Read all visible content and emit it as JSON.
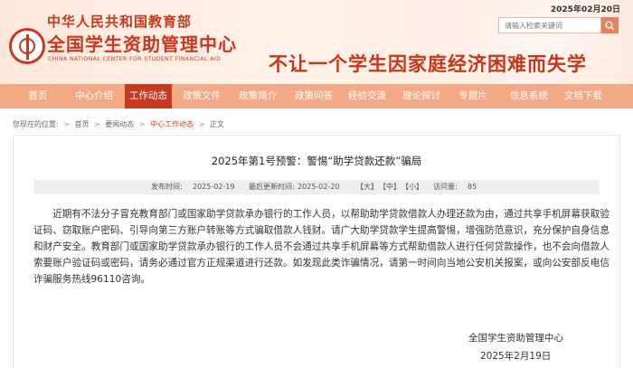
{
  "header": {
    "date": "2025年02月20日",
    "ministry": "中华人民共和国教育部",
    "center_name": "全国学生资助管理中心",
    "center_en": "CHINA NATIONAL CENTER FOR STUDENT FINANCIAL AID",
    "slogan": "不让一个学生因家庭经济困难而失学",
    "search": {
      "placeholder": "请输入检索关键词"
    }
  },
  "nav": {
    "items": [
      {
        "label": "首页"
      },
      {
        "label": "中心介绍"
      },
      {
        "label": "工作动态",
        "active": true
      },
      {
        "label": "政策文件"
      },
      {
        "label": "政策简介"
      },
      {
        "label": "政策问答"
      },
      {
        "label": "经验交流"
      },
      {
        "label": "理论探讨"
      },
      {
        "label": "专题片"
      },
      {
        "label": "信息系统"
      },
      {
        "label": "文档下载"
      }
    ]
  },
  "breadcrumb": {
    "prefix": "您现在的位置:",
    "items": [
      "首页",
      "要闻动态",
      "中心工作动态",
      "正文"
    ]
  },
  "article": {
    "title": "2025年第1号预警：警惕“助学贷款还款”骗局",
    "publish_label": "发布时间:",
    "publish_date": "2025-02-19",
    "update_label": "最后更新时间:",
    "update_date": "2025-02-20",
    "font_sizes": [
      "【大】",
      "【中】",
      "【小】"
    ],
    "views_label": "访问量:",
    "views": "85",
    "body": "近期有不法分子冒充教育部门或国家助学贷款承办银行的工作人员，以帮助助学贷款借款人办理还款为由，通过共享手机屏幕获取验证码、窃取账户密码、引导向第三方账户转账等方式骗取借款人钱财。请广大助学贷款学生提高警惕，增强防范意识，充分保护自身信息和财产安全。教育部门或国家助学贷款承办银行的工作人员不会通过共享手机屏幕等方式帮助借款人进行任何贷款操作，也不会向借款人索要账户验证码或密码，请务必通过官方正规渠道进行还款。如发现此类诈骗情况，请第一时间向当地公安机关报案，或向公安部反电信诈骗服务热线96110咨询。",
    "sign_org": "全国学生资助管理中心",
    "sign_date": "2025年2月19日"
  },
  "colors": {
    "brand_red": "#c6391f",
    "nav_bg": "#f3a986",
    "header_bg": "#fde7dc"
  },
  "icons": {
    "logo": "education-ministry-emblem",
    "search": "search-icon"
  }
}
